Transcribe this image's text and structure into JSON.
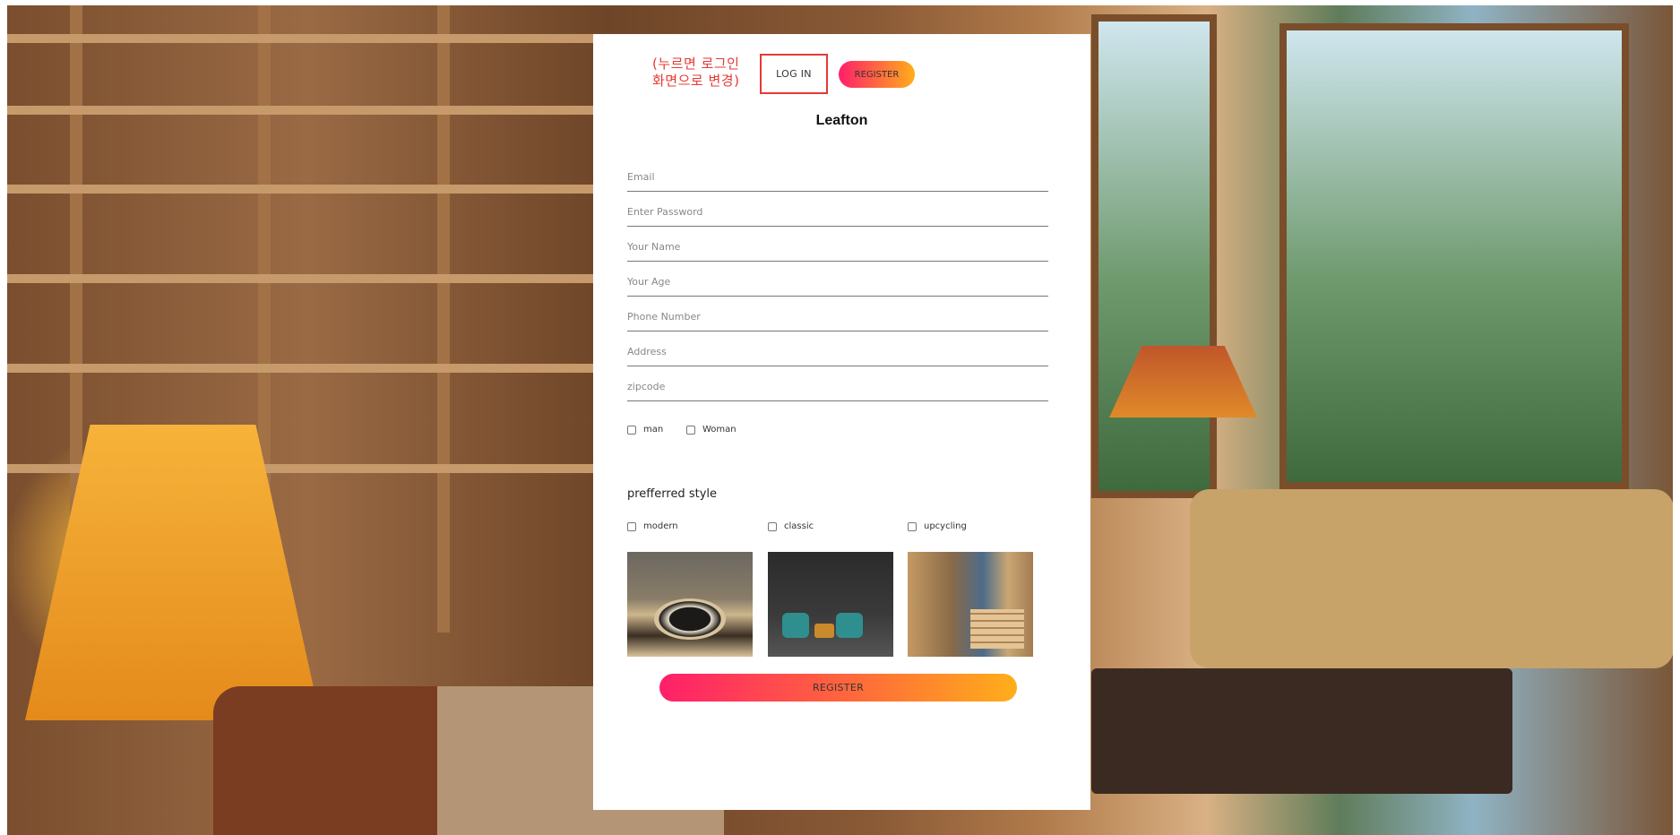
{
  "annotation": "(누르면 로그인 화면으로 변경)",
  "nav": {
    "login_label": "LOG IN",
    "register_label": "REGISTER"
  },
  "brand": "Leafton",
  "fields": {
    "email": "Email",
    "password": "Enter Password",
    "name": "Your Name",
    "age": "Your Age",
    "phone": "Phone Number",
    "address": "Address",
    "zipcode": "zipcode"
  },
  "gender": {
    "man": "man",
    "woman": "Woman"
  },
  "style": {
    "title": "prefferred style",
    "options": [
      "modern",
      "classic",
      "upcycling"
    ]
  },
  "submit_label": "REGISTER",
  "colors": {
    "annotation_red": "#e53935",
    "gradient_start": "#ff1f6a",
    "gradient_end": "#ffae1a"
  },
  "icons": {
    "checkbox": "checkbox-icon"
  }
}
